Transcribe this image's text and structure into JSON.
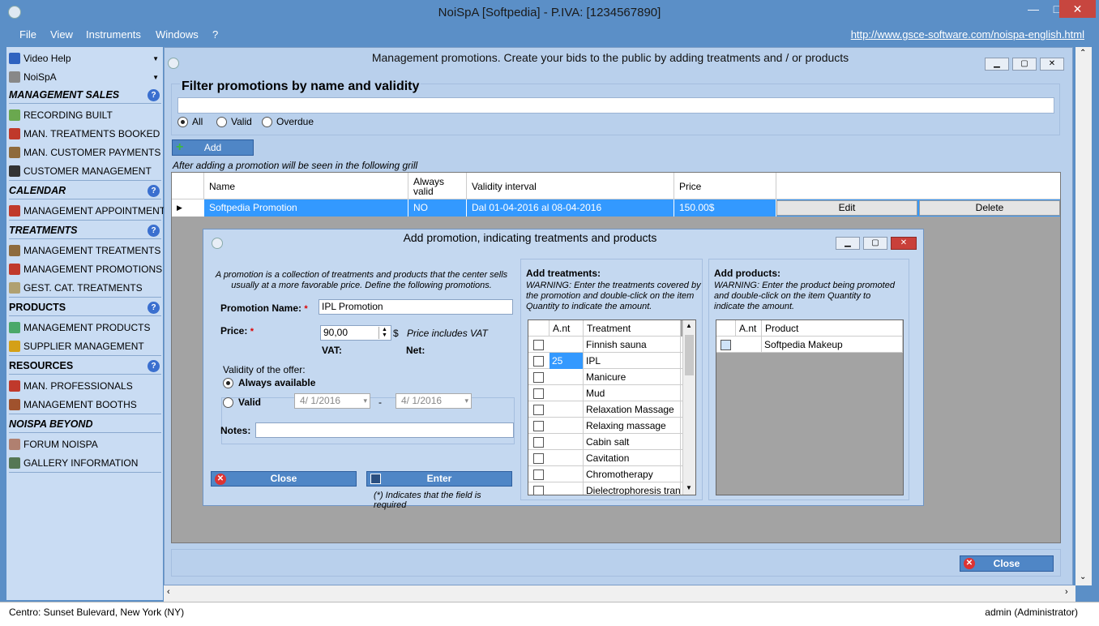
{
  "window": {
    "title": "NoiSpA  [Softpedia] - P.IVA: [1234567890]",
    "min": "—",
    "max": "□",
    "close": "✕"
  },
  "menu": {
    "items": [
      "File",
      "View",
      "Instruments",
      "Windows",
      "?"
    ],
    "link": "http://www.gsce-software.com/noispa-english.html"
  },
  "sidebar": {
    "top": [
      {
        "label": "Video Help",
        "icon": "help-circle-icon",
        "color": "#2f63c0"
      },
      {
        "label": "NoiSpA",
        "icon": "app-icon",
        "color": "#888888"
      }
    ],
    "sections": [
      {
        "title": "MANAGEMENT SALES",
        "items": [
          {
            "label": "RECORDING BUILT",
            "icon": "receipt-icon",
            "color": "#6aa84f"
          },
          {
            "label": "MAN. TREATMENTS BOOKED",
            "icon": "book-icon",
            "color": "#c0392b"
          },
          {
            "label": "MAN. CUSTOMER PAYMENTS",
            "icon": "payment-icon",
            "color": "#8e6b3d"
          },
          {
            "label": "CUSTOMER MANAGEMENT",
            "icon": "person-icon",
            "color": "#333333"
          }
        ]
      },
      {
        "title": "CALENDAR",
        "items": [
          {
            "label": "MANAGEMENT APPOINTMENTS",
            "icon": "calendar-icon",
            "color": "#c0392b"
          }
        ]
      },
      {
        "title": "TREATMENTS",
        "items": [
          {
            "label": "MANAGEMENT TREATMENTS",
            "icon": "bed-icon",
            "color": "#8e6b3d"
          },
          {
            "label": "MANAGEMENT PROMOTIONS",
            "icon": "megaphone-icon",
            "color": "#c0392b"
          },
          {
            "label": "GEST. CAT. TREATMENTS",
            "icon": "tag-icon",
            "color": "#b0a070"
          }
        ]
      },
      {
        "title": "PRODUCTS",
        "items": [
          {
            "label": "MANAGEMENT PRODUCTS",
            "icon": "flask-icon",
            "color": "#4aa86a"
          },
          {
            "label": "SUPPLIER MANAGEMENT",
            "icon": "supplier-icon",
            "color": "#d4a017"
          }
        ]
      },
      {
        "title": "RESOURCES",
        "items": [
          {
            "label": "MAN. PROFESSIONALS",
            "icon": "professional-icon",
            "color": "#c0392b"
          },
          {
            "label": "MANAGEMENT BOOTHS",
            "icon": "door-icon",
            "color": "#a0522d"
          }
        ]
      },
      {
        "title": "NOISPA BEYOND",
        "items": [
          {
            "label": "FORUM NOISPA",
            "icon": "heart-icon",
            "color": "#b08070"
          },
          {
            "label": "GALLERY INFORMATION",
            "icon": "gallery-icon",
            "color": "#557755"
          }
        ]
      }
    ]
  },
  "main": {
    "title": "Management promotions. Create your bids to the public by adding treatments and / or products",
    "filter_title": "Filter promotions by name and validity",
    "filter_value": "",
    "radios": [
      "All",
      "Valid",
      "Overdue"
    ],
    "radio_selected": "All",
    "add_label": "Add",
    "grid_note": "After adding a promotion will be seen in the following grill",
    "columns": [
      "Name",
      "Always valid",
      "Validity interval",
      "Price"
    ],
    "row": {
      "name": "Softpedia Promotion",
      "always_valid": "NO",
      "interval": "Dal 01-04-2016 al 08-04-2016",
      "price": "150.00$",
      "edit": "Edit",
      "delete": "Delete"
    },
    "close_label": "Close"
  },
  "dialog": {
    "title": "Add promotion, indicating treatments and products",
    "description": "A promotion is a collection of treatments and products that the center sells usually at a more favorable price. Define the following promotions.",
    "promo_name_label": "Promotion Name:",
    "promo_name_value": "IPL Promotion",
    "price_label": "Price:",
    "price_value": "90,00",
    "currency": "$",
    "price_note": "Price includes VAT",
    "vat_label": "VAT:",
    "net_label": "Net:",
    "validity_label": "Validity of the offer:",
    "always_label": "Always available",
    "valid_label": "Valid",
    "date_from": "4/ 1/2016",
    "date_to": "4/ 1/2016",
    "date_sep": "-",
    "notes_label": "Notes:",
    "notes_value": "",
    "close_label": "Close",
    "enter_label": "Enter",
    "required_note": "(*) Indicates that the field is required",
    "required_mark": "*",
    "treatments": {
      "title": "Add treatments:",
      "warning": "WARNING: Enter the treatments covered by the promotion and double-click on the item Quantity to indicate the amount.",
      "col_qty": "A.nt",
      "col_name": "Treatment",
      "rows": [
        {
          "qty": "",
          "name": "Finnish sauna"
        },
        {
          "qty": "25",
          "name": "IPL"
        },
        {
          "qty": "",
          "name": "Manicure"
        },
        {
          "qty": "",
          "name": "Mud"
        },
        {
          "qty": "",
          "name": "Relaxation Massage"
        },
        {
          "qty": "",
          "name": "Relaxing massage"
        },
        {
          "qty": "",
          "name": "Cabin salt"
        },
        {
          "qty": "",
          "name": "Cavitation"
        },
        {
          "qty": "",
          "name": "Chromotherapy"
        },
        {
          "qty": "",
          "name": "Dielectrophoresis tran..."
        }
      ]
    },
    "products": {
      "title": "Add products:",
      "warning": "WARNING: Enter the product being promoted and double-click on the item Quantity to indicate the amount.",
      "col_qty": "A.nt",
      "col_name": "Product",
      "rows": [
        {
          "qty": "",
          "name": "Softpedia Makeup"
        }
      ]
    }
  },
  "status": {
    "left": "Centro: Sunset Bulevard,  New York (NY)",
    "right": "admin (Administrator)"
  }
}
